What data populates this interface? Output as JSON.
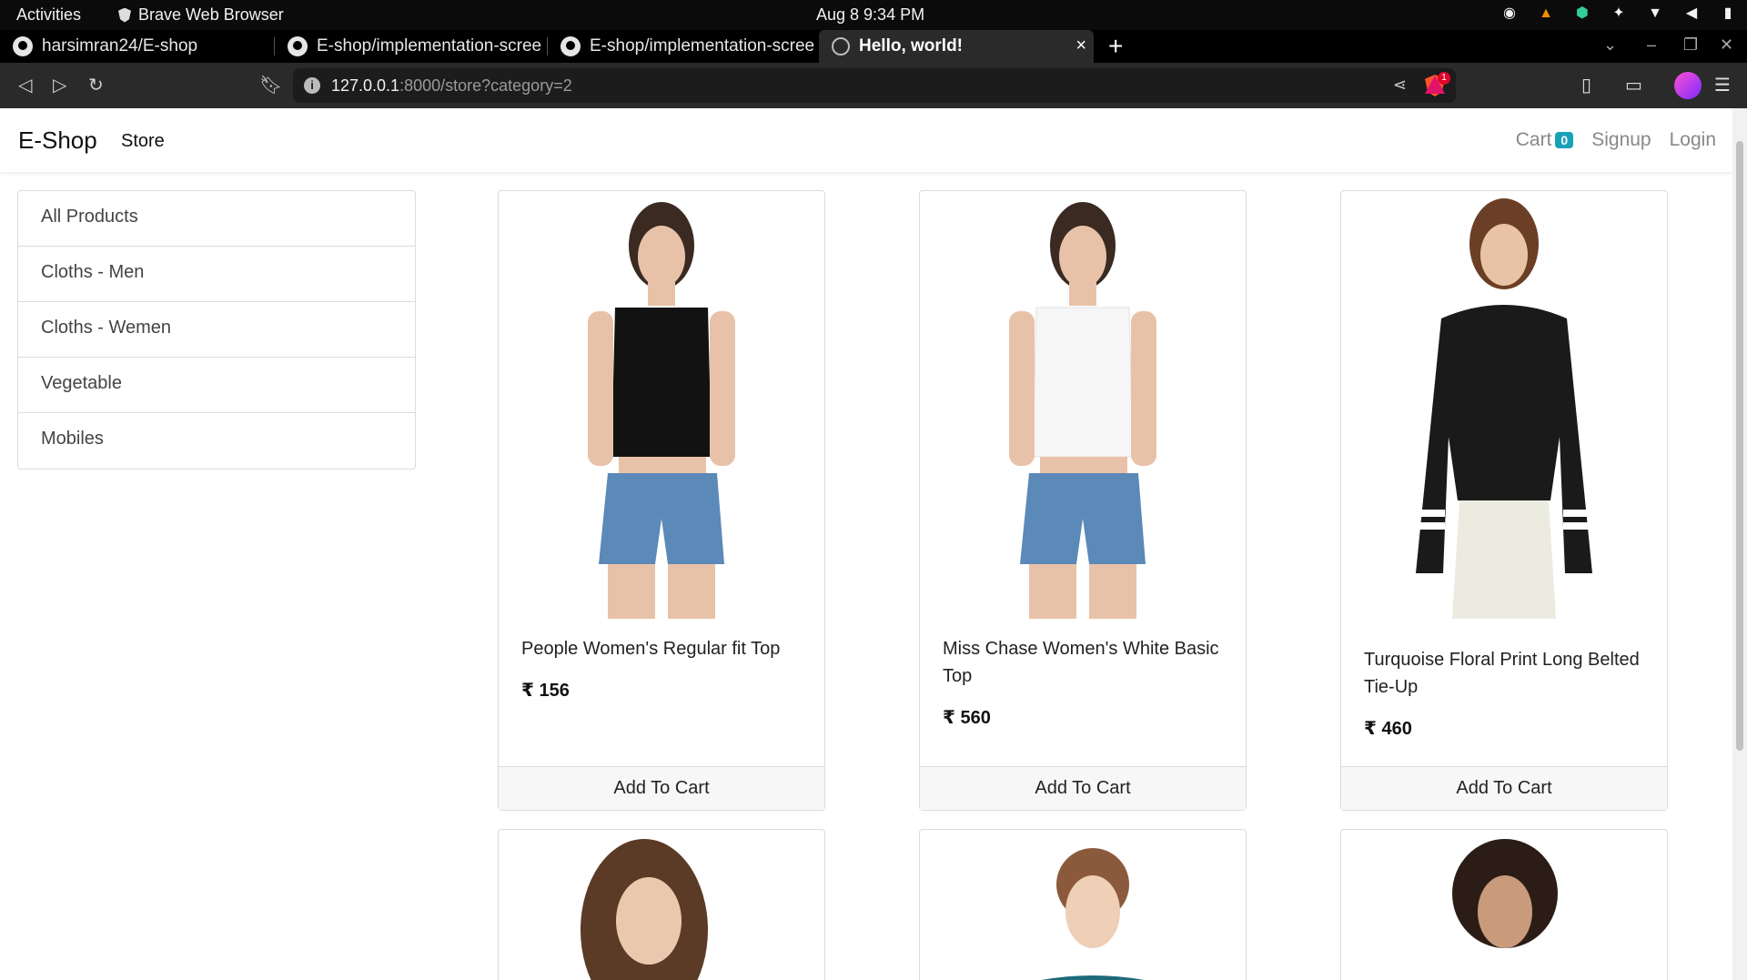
{
  "os": {
    "activities": "Activities",
    "app_name": "Brave Web Browser",
    "clock": "Aug 8  9:34 PM"
  },
  "tabs": [
    {
      "label": "harsimran24/E-shop",
      "icon": "github-icon"
    },
    {
      "label": "E-shop/implementation-scree",
      "icon": "github-icon"
    },
    {
      "label": "E-shop/implementation-scree",
      "icon": "github-icon"
    },
    {
      "label": "Hello, world!",
      "icon": "globe-icon",
      "active": true
    }
  ],
  "address": {
    "host": "127.0.0.1",
    "rest": ":8000/store?category=2",
    "rewards_count": "1"
  },
  "site": {
    "brand": "E-Shop",
    "store_link": "Store",
    "cart_label": "Cart",
    "cart_count": "0",
    "signup": "Signup",
    "login": "Login",
    "accent_color": "#17a2b8"
  },
  "categories": [
    "All Products",
    "Cloths - Men",
    "Cloths - Wemen",
    "Vegetable",
    "Mobiles"
  ],
  "products": [
    {
      "title": "People Women's Regular fit Top",
      "price": "₹ 156",
      "button": "Add To Cart"
    },
    {
      "title": "Miss Chase Women's White Basic Top",
      "price": "₹ 560",
      "button": "Add To Cart"
    },
    {
      "title": "Turquoise Floral Print Long Belted Tie-Up",
      "price": "₹ 460",
      "button": "Add To Cart"
    }
  ]
}
